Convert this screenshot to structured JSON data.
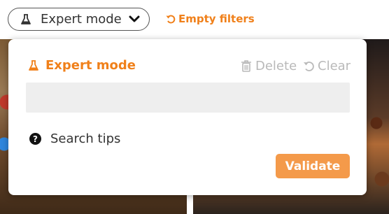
{
  "toolbar": {
    "mode_label": "Expert mode",
    "empty_filters_label": "Empty filters"
  },
  "panel": {
    "title": "Expert mode",
    "delete_label": "Delete",
    "clear_label": "Clear",
    "query_value": "",
    "search_tips_label": "Search tips",
    "validate_label": "Validate"
  },
  "icons": {
    "mode": "flask-icon",
    "dropdown": "chevron-down-icon",
    "empty_filters": "undo-icon",
    "delete": "trash-icon",
    "clear": "undo-icon",
    "tips": "question-circle-icon"
  },
  "colors": {
    "accent": "#f0801a",
    "validate_bg": "#f49a4a",
    "disabled_text": "#b9b9b9",
    "input_bg": "#eeeeee"
  }
}
